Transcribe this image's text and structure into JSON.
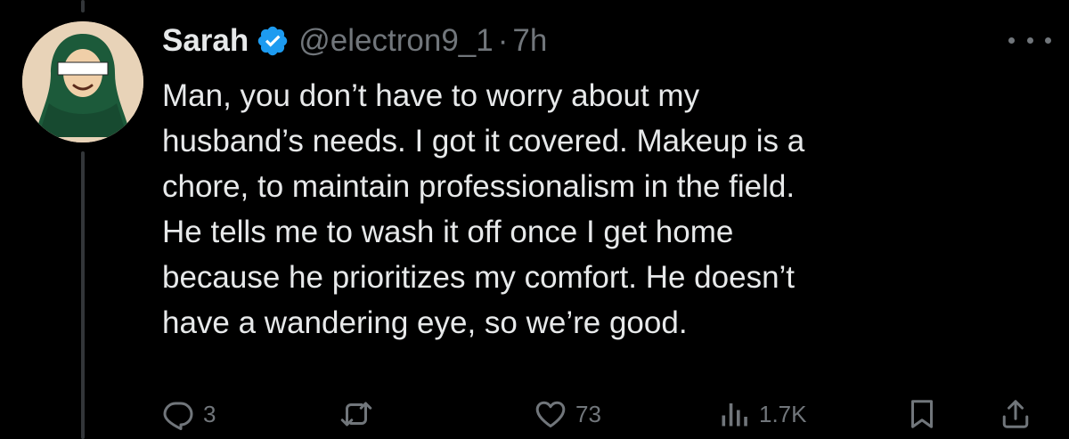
{
  "tweet": {
    "display_name": "Sarah",
    "handle": "@electron9_1",
    "separator": "·",
    "time": "7h",
    "verified": true,
    "text": "Man, you don’t have to worry about my\nhusband’s needs. I got it covered. Makeup is a\nchore, to maintain professionalism in the field.\nHe tells me to wash it off once I get home\nbecause he prioritizes my comfort. He doesn’t\nhave a wandering eye, so we’re good."
  },
  "actions": {
    "reply_count": "3",
    "repost_count": "",
    "like_count": "73",
    "views_count": "1.7K"
  },
  "icons": {
    "reply": "reply-icon",
    "repost": "repost-icon",
    "like": "heart-icon",
    "views": "views-icon",
    "bookmark": "bookmark-icon",
    "share": "share-icon",
    "more": "more-icon",
    "verified": "verified-badge-icon"
  },
  "colors": {
    "background": "#000000",
    "text": "#e7e9ea",
    "secondary": "#71767b",
    "verified": "#1d9bf0",
    "thread_line": "#333639",
    "avatar_bg": "#e8d3b8",
    "hijab": "#1c5a3a"
  }
}
